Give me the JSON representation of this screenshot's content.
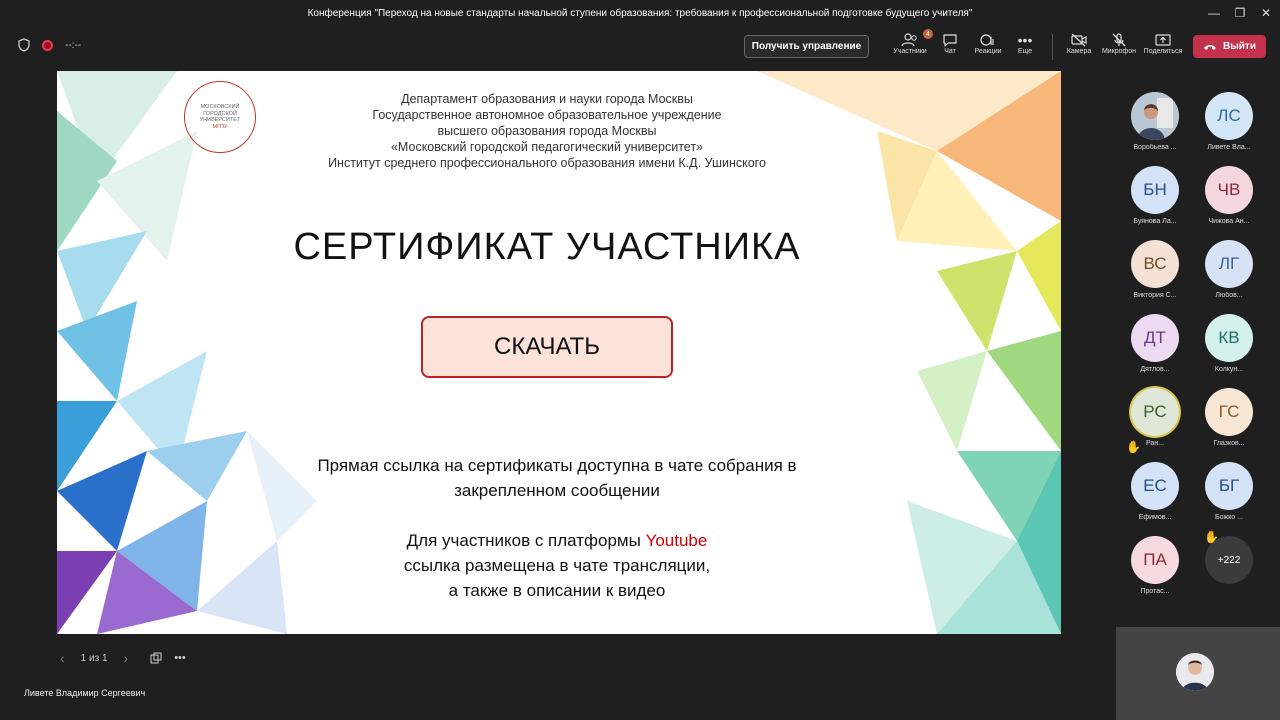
{
  "window": {
    "title": "Конференция \"Переход на новые стандарты начальной ступени образования: требования к профессиональной подготовке будущего учителя\"",
    "minimize": "—",
    "maximize": "❐",
    "close": "✕"
  },
  "toolbar": {
    "timer": "--:--",
    "request_control": "Получить управление",
    "participants_label": "Участники",
    "participants_badge": "4",
    "chat_label": "Чат",
    "reactions_label": "Реакции",
    "more_label": "Еще",
    "camera_label": "Камера",
    "mic_label": "Микрофон",
    "share_label": "Поделиться",
    "leave_label": "Выйти"
  },
  "slide": {
    "logo_text": [
      "МОСКОВСКИЙ",
      "ГОРОДСКОЙ",
      "УНИВЕРСИТЕТ",
      "МГПУ"
    ],
    "dept_lines": [
      "Департамент образования и науки города Москвы",
      "Государственное автономное образовательное учреждение",
      "высшего образования города Москвы",
      "«Московский городской педагогический университет»",
      "Институт среднего профессионального образования имени К.Д. Ушинского"
    ],
    "title": "СЕРТИФИКАТ УЧАСТНИКА",
    "download": "СКАЧАТЬ",
    "info1_line1": "Прямая ссылка на сертификаты доступна в чате собрания в",
    "info1_line2": "закрепленном сообщении",
    "info2_prefix": "Для участников с платформы ",
    "info2_link": "Youtube",
    "info2_line2": "ссылка размещена в чате трансляции,",
    "info2_line3": "а также в описании к видео"
  },
  "slide_nav": {
    "page": "1 из 1"
  },
  "presenter_name": "Ливете Владимир Сергеевич",
  "participants": [
    {
      "initials": "",
      "name": "Воробьева ...",
      "color": "#cfd8e3",
      "text_color": "#333"
    },
    {
      "initials": "ЛС",
      "name": "Ливете Вла...",
      "color": "#d3e6f5",
      "text_color": "#2d6aa3"
    },
    {
      "initials": "БН",
      "name": "Буянова Ла...",
      "color": "#d3e2f6",
      "text_color": "#264f8c"
    },
    {
      "initials": "ЧВ",
      "name": "Чижова Ан...",
      "color": "#f4d7dc",
      "text_color": "#8c2a3c"
    },
    {
      "initials": "ВС",
      "name": "Виктория С...",
      "color": "#f2e1d4",
      "text_color": "#7a4b2a"
    },
    {
      "initials": "ЛГ",
      "name": "Любов...",
      "color": "#d7e3f5",
      "text_color": "#3a5f99"
    },
    {
      "initials": "ДТ",
      "name": "Дятлов...",
      "color": "#ecd9f2",
      "text_color": "#6e3585"
    },
    {
      "initials": "КВ",
      "name": "Колкун...",
      "color": "#d3f0ed",
      "text_color": "#21706a"
    },
    {
      "initials": "РС",
      "name": "Ран...",
      "color": "#dfe8d8",
      "text_color": "#3a5c2b",
      "hand": "✋"
    },
    {
      "initials": "ГС",
      "name": "Глазков...",
      "color": "#f7e6d3",
      "text_color": "#8c5a22"
    },
    {
      "initials": "ЕС",
      "name": "Ефимов...",
      "color": "#d3e2f6",
      "text_color": "#264f8c"
    },
    {
      "initials": "БГ",
      "name": "Божко ...",
      "color": "#d3e2f6",
      "text_color": "#264f8c"
    },
    {
      "initials": "ПА",
      "name": "Протас...",
      "color": "#f6d9dd",
      "text_color": "#8c2a3c"
    },
    {
      "initials": "+222",
      "name": "",
      "color": "#3b3b3b",
      "text_color": "#fff",
      "hand": "✋"
    }
  ]
}
